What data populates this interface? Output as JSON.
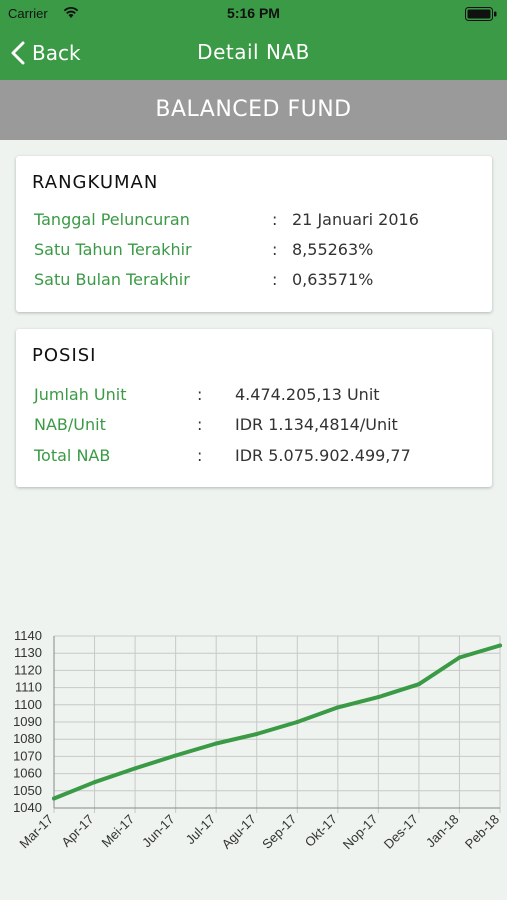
{
  "status_bar": {
    "carrier": "Carrier",
    "time": "5:16 PM"
  },
  "nav": {
    "back_label": "Back",
    "title": "Detail NAB"
  },
  "fund_name": "BALANCED FUND",
  "summary": {
    "heading": "RANGKUMAN",
    "rows": [
      {
        "label": "Tanggal Peluncuran",
        "sep": ":",
        "value": "21 Januari 2016"
      },
      {
        "label": "Satu Tahun Terakhir",
        "sep": ":",
        "value": "8,55263%"
      },
      {
        "label": "Satu Bulan Terakhir",
        "sep": ":",
        "value": "0,63571%"
      }
    ]
  },
  "position": {
    "heading": "POSISI",
    "rows": [
      {
        "label": "Jumlah Unit",
        "sep": ":",
        "value": "4.474.205,13 Unit"
      },
      {
        "label": "NAB/Unit",
        "sep": ":",
        "value": "IDR 1.134,4814/Unit"
      },
      {
        "label": "Total NAB",
        "sep": ":",
        "value": "IDR 5.075.902.499,77"
      }
    ]
  },
  "colors": {
    "accent": "#3a9a45",
    "header_gray": "#9a9a9a",
    "background": "#eef3ef"
  },
  "chart_data": {
    "type": "line",
    "categories": [
      "Mar-17",
      "Apr-17",
      "Mei-17",
      "Jun-17",
      "Jul-17",
      "Agu-17",
      "Sep-17",
      "Okt-17",
      "Nop-17",
      "Des-17",
      "Jan-18",
      "Peb-18"
    ],
    "series": [
      {
        "values": [
          1045.5,
          1055,
          1063,
          1070.5,
          1077.5,
          1083,
          1090,
          1098.5,
          1104.5,
          1112,
          1127.5,
          1134.5
        ]
      }
    ],
    "y_ticks": [
      1040,
      1050,
      1060,
      1070,
      1080,
      1090,
      1100,
      1110,
      1120,
      1130,
      1140
    ],
    "ylim": [
      1040,
      1140
    ],
    "grid": true,
    "legend": "none",
    "line_color": "#3a9a45"
  }
}
